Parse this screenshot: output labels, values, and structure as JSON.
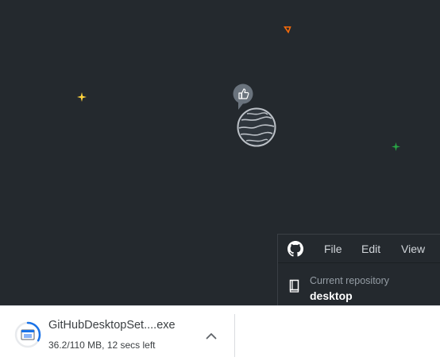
{
  "app": {
    "menu": {
      "file": "File",
      "edit": "Edit",
      "view": "View"
    },
    "repository": {
      "label": "Current repository",
      "name": "desktop"
    }
  },
  "download": {
    "file_name": "GitHubDesktopSet....exe",
    "status": "36.2/110 MB, 12 secs left",
    "progress": 0.33
  },
  "colors": {
    "canvas": "#24292e",
    "star_yellow": "#ffd33d",
    "star_orange": "#f66a0a",
    "star_green": "#28a745",
    "progress_blue": "#1a73e8"
  },
  "icons": {
    "app_logo": "github-octocat-icon",
    "repo": "repository-icon",
    "speech_bubble": "thumbs-up-bubble-icon",
    "planet": "planet-icon",
    "download_file": "installer-file-icon",
    "chevron": "chevron-up-icon"
  }
}
